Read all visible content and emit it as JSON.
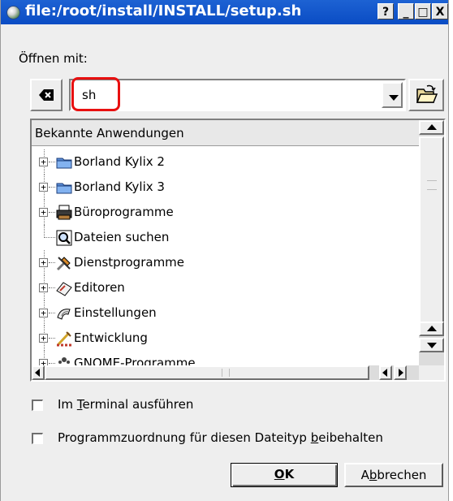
{
  "window": {
    "title": "file:/root/install/INSTALL/setup.sh",
    "help_glyph": "?",
    "min_glyph": "_",
    "max_glyph": "□",
    "close_glyph": "X"
  },
  "open_with_label": "Öffnen mit:",
  "command_input": {
    "value": "sh"
  },
  "apps": {
    "header": "Bekannte Anwendungen",
    "items": [
      {
        "label": "Borland Kylix 2",
        "icon": "folder-icon",
        "expandable": true
      },
      {
        "label": "Borland Kylix 3",
        "icon": "folder-icon",
        "expandable": true
      },
      {
        "label": "Büroprogramme",
        "icon": "office-printer-icon",
        "expandable": true
      },
      {
        "label": "Dateien suchen",
        "icon": "find-files-icon",
        "expandable": false
      },
      {
        "label": "Dienstprogramme",
        "icon": "tools-icon",
        "expandable": true
      },
      {
        "label": "Editoren",
        "icon": "editor-icon",
        "expandable": true
      },
      {
        "label": "Einstellungen",
        "icon": "settings-icon",
        "expandable": true
      },
      {
        "label": "Entwicklung",
        "icon": "development-icon",
        "expandable": true
      },
      {
        "label": "GNOME-Programme",
        "icon": "gnome-icon",
        "expandable": true
      }
    ]
  },
  "options": {
    "terminal": {
      "pre": "Im ",
      "u": "T",
      "post": "erminal ausführen",
      "checked": false
    },
    "remember": {
      "pre": "Programmzuordnung für diesen Dateityp ",
      "u": "b",
      "post": "eibehalten",
      "checked": false
    }
  },
  "buttons": {
    "ok": {
      "u": "O",
      "post": "K"
    },
    "cancel": {
      "pre": "A",
      "u": "b",
      "post": "brechen"
    }
  },
  "colors": {
    "titlebar": "#0a4cc4",
    "highlight_annotation": "#e81010"
  }
}
